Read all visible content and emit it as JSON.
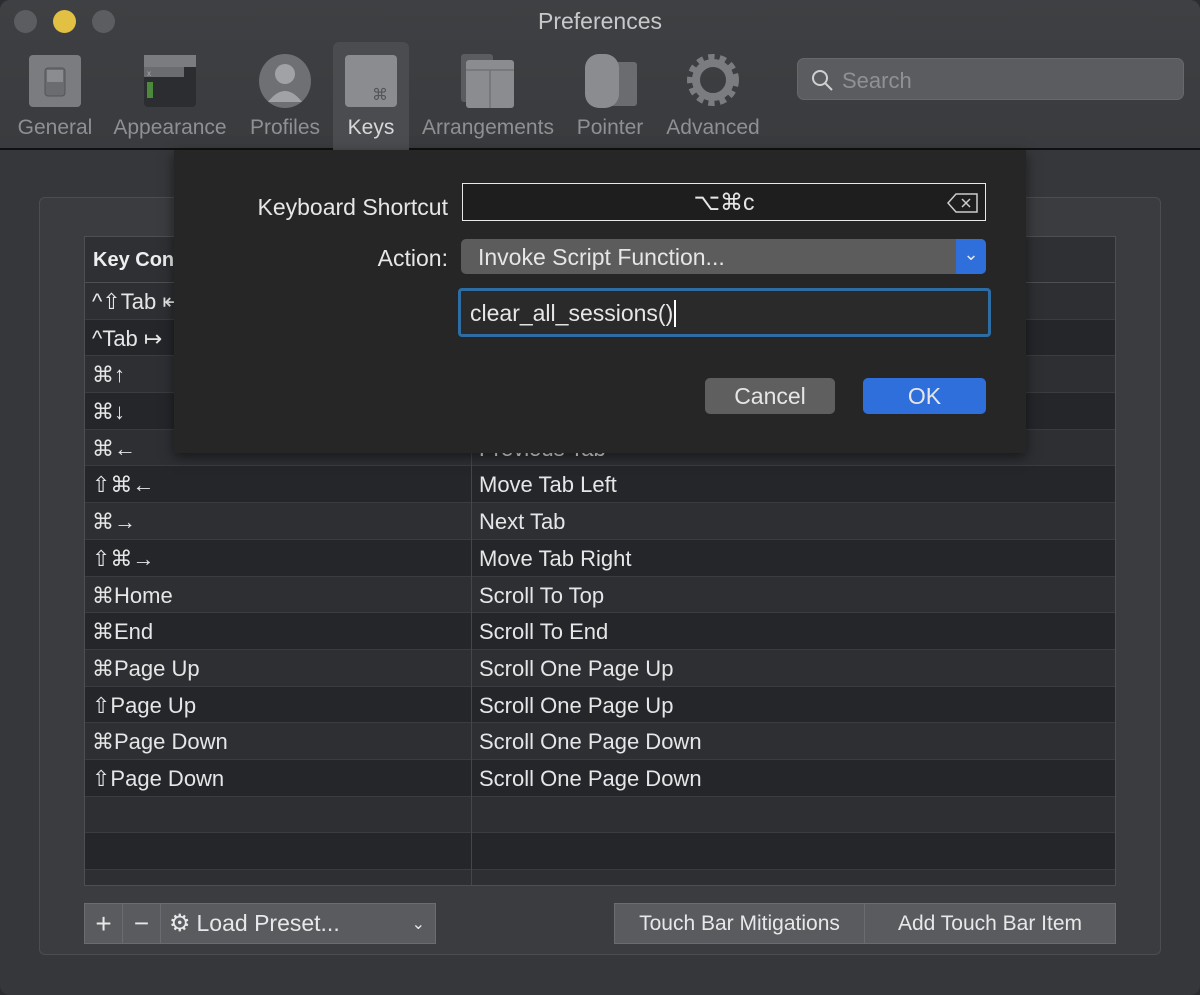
{
  "window": {
    "title": "Preferences"
  },
  "toolbar": {
    "items": [
      {
        "label": "General",
        "icon": "switch-icon"
      },
      {
        "label": "Appearance",
        "icon": "terminal-window-icon"
      },
      {
        "label": "Profiles",
        "icon": "person-icon"
      },
      {
        "label": "Keys",
        "icon": "command-key-icon",
        "selected": true
      },
      {
        "label": "Arrangements",
        "icon": "windows-icon"
      },
      {
        "label": "Pointer",
        "icon": "mouse-icon"
      },
      {
        "label": "Advanced",
        "icon": "gear-icon"
      }
    ]
  },
  "search": {
    "placeholder": "Search"
  },
  "table": {
    "header": "Key Con",
    "rows": [
      [
        "^⇧Tab ⇤",
        ""
      ],
      [
        "^Tab ↦",
        ""
      ],
      [
        "⌘↑",
        ""
      ],
      [
        "⌘↓",
        ""
      ],
      [
        "⌘←",
        "Previous Tab"
      ],
      [
        "⇧⌘←",
        "Move Tab Left"
      ],
      [
        "⌘→",
        "Next Tab"
      ],
      [
        "⇧⌘→",
        "Move Tab Right"
      ],
      [
        "⌘Home",
        "Scroll To Top"
      ],
      [
        "⌘End",
        "Scroll To End"
      ],
      [
        "⌘Page Up",
        "Scroll One Page Up"
      ],
      [
        "⇧Page Up",
        "Scroll One Page Up"
      ],
      [
        "⌘Page Down",
        "Scroll One Page Down"
      ],
      [
        "⇧Page Down",
        "Scroll One Page Down"
      ]
    ]
  },
  "bottom": {
    "add": "+",
    "remove": "−",
    "load_preset": "Load Preset...",
    "touch_bar_mitigations": "Touch Bar Mitigations",
    "add_touch_bar_item": "Add Touch Bar Item"
  },
  "dialog": {
    "shortcut_label": "Keyboard Shortcut",
    "shortcut_value": "⌥⌘c",
    "action_label": "Action:",
    "action_value": "Invoke Script Function...",
    "script_value": "clear_all_sessions()",
    "cancel": "Cancel",
    "ok": "OK"
  },
  "colors": {
    "accent": "#2f6fdb",
    "focus": "#2e6da4",
    "minimize": "#e2c044"
  }
}
